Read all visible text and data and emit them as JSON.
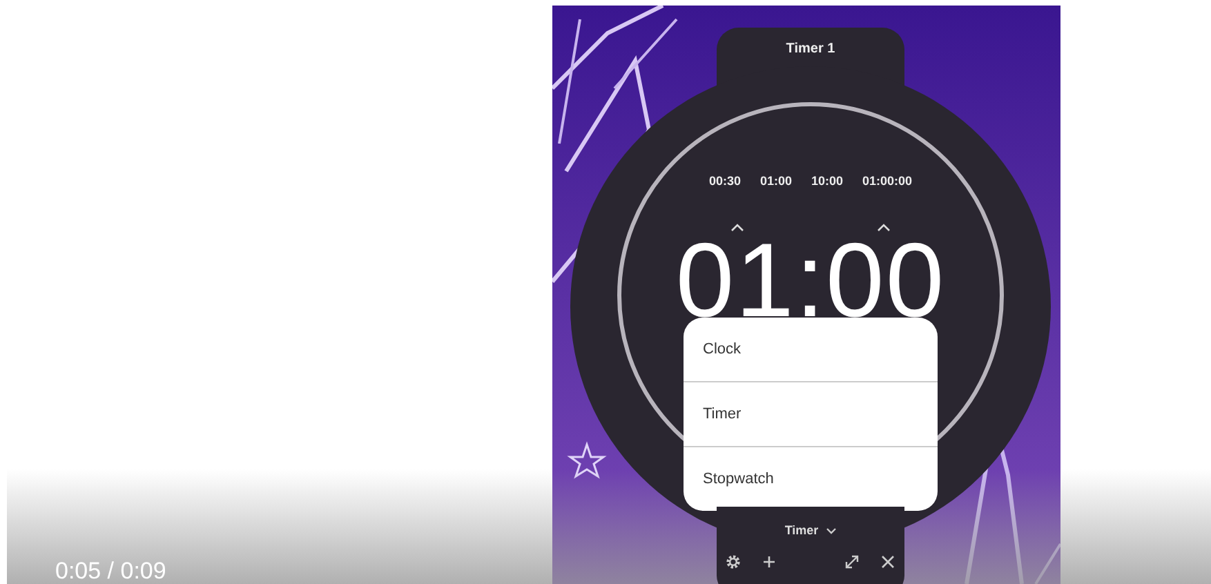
{
  "widget": {
    "title": "Timer 1",
    "presets": [
      "00:30",
      "01:00",
      "10:00",
      "01:00:00"
    ],
    "time": "01:00",
    "mode": "Timer"
  },
  "menu": {
    "items": [
      {
        "label": "Clock"
      },
      {
        "label": "Timer"
      },
      {
        "label": "Stopwatch"
      }
    ]
  },
  "player": {
    "time": "0:05 / 0:09"
  }
}
